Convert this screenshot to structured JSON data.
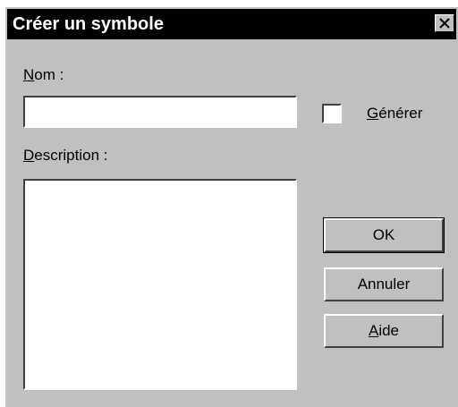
{
  "window": {
    "title": "Créer un symbole",
    "close_glyph": "close-icon"
  },
  "form": {
    "nom_label_key": "N",
    "nom_label_rest": "om :",
    "nom_value": "",
    "generer_label_key": "G",
    "generer_label_rest": "énérer",
    "generer_checked": false,
    "description_label_key": "D",
    "description_label_rest": "escription :",
    "description_value": ""
  },
  "buttons": {
    "ok": "OK",
    "cancel": "Annuler",
    "help_key": "A",
    "help_rest": "ide"
  },
  "colors": {
    "dialog_bg": "#c0c0c0",
    "titlebar_bg": "#000000",
    "titlebar_text": "#ffffff"
  }
}
